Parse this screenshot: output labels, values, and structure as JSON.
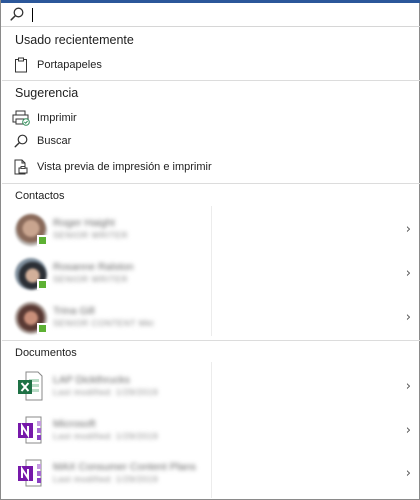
{
  "search": {
    "value": "",
    "placeholder": ""
  },
  "recent": {
    "header": "Usado recientemente",
    "items": [
      {
        "label": "Portapapeles",
        "icon": "clipboard-icon"
      }
    ]
  },
  "suggestion": {
    "header": "Sugerencia",
    "items": [
      {
        "label": "Imprimir",
        "icon": "printer-icon"
      },
      {
        "label": "Buscar",
        "icon": "search-icon"
      },
      {
        "label": "Vista previa de impresión e imprimir",
        "icon": "print-preview-icon"
      }
    ]
  },
  "contacts": {
    "header": "Contactos",
    "items": [
      {
        "name": "Roger Haight",
        "subtitle": "SENIOR WRITER",
        "presence": "available",
        "presence_color": "#5db133"
      },
      {
        "name": "Rosanne Ralston",
        "subtitle": "SENIOR WRITER",
        "presence": "available",
        "presence_color": "#5db133"
      },
      {
        "name": "Trina Gill",
        "subtitle": "SENIOR CONTENT Mkt",
        "presence": "available",
        "presence_color": "#5db133"
      }
    ]
  },
  "documents": {
    "header": "Documentos",
    "items": [
      {
        "name": "LAP Dickthrucks",
        "subtitle": "Last modified: 1/29/2019",
        "app": "excel",
        "color": "#1e7145"
      },
      {
        "name": "Microsoft",
        "subtitle": "Last modified: 1/29/2019",
        "app": "onenote",
        "color": "#7719aa"
      },
      {
        "name": "MAX Consumer Content Plans",
        "subtitle": "Last modified: 1/29/2019",
        "app": "onenote",
        "color": "#7719aa"
      }
    ]
  },
  "colors": {
    "accent": "#2b579a",
    "presence": "#5db133",
    "excel": "#1e7145",
    "onenote": "#7719aa"
  }
}
